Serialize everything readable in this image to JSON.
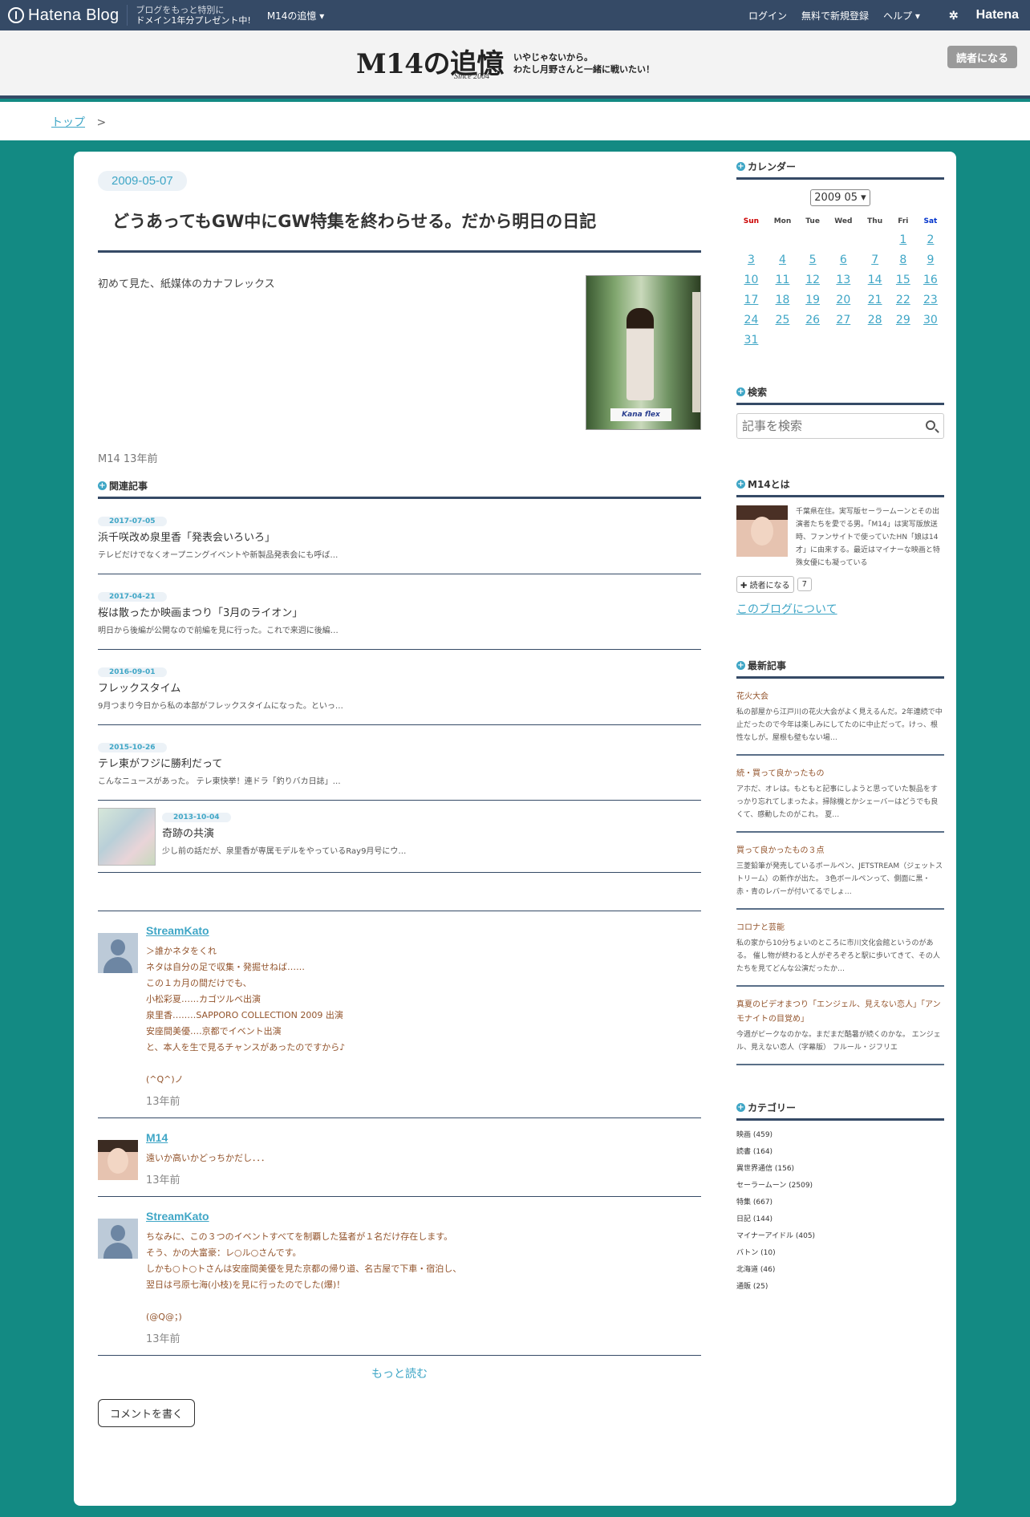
{
  "hatena_bar": {
    "logo_text": "Hatena Blog",
    "promo_line1": "ブログをもっと特別に",
    "promo_line2": "ドメイン1年分プレゼント中!",
    "blog_menu": "M14の追憶 ▾",
    "login": "ログイン",
    "signup": "無料で新規登録",
    "help": "ヘルプ ▾",
    "brand": "Hatena"
  },
  "blog_header": {
    "title": "M14の追憶",
    "since": "Since 2004",
    "desc_line1": "いやじゃないから。",
    "desc_line2": "わたし月野さんと一緒に戦いたい！",
    "subscribe": "読者になる"
  },
  "breadcrumb": {
    "top": "トップ",
    "sep": ">"
  },
  "entry": {
    "date": "2009-05-07",
    "title": "どうあってもGW中にGW特集を終わらせる。だから明日の日記",
    "body": "初めて見た、紙媒体のカナフレックス",
    "photo_logo": "Kana flex",
    "author": "M14",
    "time": "13年前"
  },
  "related": {
    "heading": "関連記事",
    "items": [
      {
        "date": "2017-07-05",
        "title": "浜千咲改め泉里香「発表会いろいろ」",
        "snippet": "テレビだけでなくオープニングイベントや新製品発表会にも呼ば…"
      },
      {
        "date": "2017-04-21",
        "title": "桜は散ったか映画まつり「3月のライオン」",
        "snippet": "明日から後編が公開なので前編を見に行った。これで来週に後編…"
      },
      {
        "date": "2016-09-01",
        "title": "フレックスタイム",
        "snippet": "9月つまり今日から私の本部がフレックスタイムになった。といっ…"
      },
      {
        "date": "2015-10-26",
        "title": "テレ東がフジに勝利だって",
        "snippet": "こんなニュースがあった。 テレ東快挙！連ドラ「釣りバカ日誌」…"
      },
      {
        "date": "2013-10-04",
        "title": "奇跡の共演",
        "snippet": "少し前の話だが、泉里香が専属モデルをやっているRay9月号にウ…"
      }
    ]
  },
  "comments": [
    {
      "name": "StreamKato",
      "lines": [
        "＞誰かネタをくれ",
        "ネタは自分の足で収集・発掘せねば‥‥‥",
        "この１カ月の間だけでも、",
        "小松彩夏‥‥‥カゴツルベ出演",
        "泉里香‥‥‥‥SAPPORO COLLECTION 2009 出演",
        "安座間美優‥‥京都でイベント出演",
        "と、本人を生で見るチャンスがあったのですから♪",
        "",
        "(^Q^)ノ"
      ],
      "time": "13年前"
    },
    {
      "name": "M14",
      "lines": [
        "遠いか高いかどっちかだし．．．"
      ],
      "time": "13年前"
    },
    {
      "name": "StreamKato",
      "lines": [
        "ちなみに、この３つのイベントすべてを制覇した猛者が１名だけ存在します。",
        "そう、かの大富豪：レ○ル○さんです。",
        "しかも○ト○トさんは安座間美優を見た京都の帰り道、名古屋で下車・宿泊し、",
        "翌日は弓原七海(小枝)を見に行ったのでした(爆)！",
        "",
        "(@Q@；)"
      ],
      "time": "13年前"
    }
  ],
  "more_label": "もっと読む",
  "write_comment": "コメントを書く",
  "sidebar": {
    "calendar": {
      "heading": "カレンダー",
      "selected": "2009 05",
      "weekdays": [
        "Sun",
        "Mon",
        "Tue",
        "Wed",
        "Thu",
        "Fri",
        "Sat"
      ],
      "weeks": [
        [
          "",
          "",
          "",
          "",
          "",
          "1",
          "2"
        ],
        [
          "3",
          "4",
          "5",
          "6",
          "7",
          "8",
          "9"
        ],
        [
          "10",
          "11",
          "12",
          "13",
          "14",
          "15",
          "16"
        ],
        [
          "17",
          "18",
          "19",
          "20",
          "21",
          "22",
          "23"
        ],
        [
          "24",
          "25",
          "26",
          "27",
          "28",
          "29",
          "30"
        ],
        [
          "31",
          "",
          "",
          "",
          "",
          "",
          ""
        ]
      ]
    },
    "search": {
      "heading": "検索",
      "placeholder": "記事を検索"
    },
    "about": {
      "heading": "M14とは",
      "desc": "千葉県在住。実写版セーラームーンとその出演者たちを愛でる男。「M14」は実写版放送時、ファンサイトで使っていたHN「娘は14才」に由来する。最近はマイナーな映画と特殊女優にも凝っている",
      "reader_btn": "読者になる",
      "reader_count": "7",
      "about_link": "このブログについて"
    },
    "recent": {
      "heading": "最新記事",
      "items": [
        {
          "title": "花火大会",
          "snippet": "私の部屋から江戸川の花火大会がよく見えるんだ。2年連続で中止だったので今年は楽しみにしてたのに中止だって。けっ、根性なしが。屋根も壁もない場…"
        },
        {
          "title": "続・買って良かったもの",
          "snippet": "アホだ、オレは。もともと記事にしようと思っていた製品をすっかり忘れてしまったよ。掃除機とかシェーバーはどうでも良くて、感動したのがこれ。 夏…"
        },
        {
          "title": "買って良かったもの３点",
          "snippet": "三菱鉛筆が発売しているボールペン、JETSTREAM（ジェットストリーム）の新作が出た。 3色ボールペンって、側面に黒・赤・青のレバーが付いてるでしょ…"
        },
        {
          "title": "コロナと芸能",
          "snippet": "私の家から10分ちょいのところに市川文化会館というのがある。 催し物が終わると人がぞろぞろと駅に歩いてきて、その人たちを見てどんな公演だったか…"
        },
        {
          "title": "真夏のビデオまつり「エンジェル、見えない恋人」「アンモナイトの目覚め」",
          "snippet": "今週がピークなのかな。まだまだ酷暑が続くのかな。 エンジェル、見えない恋人（字幕版） フルール・ジフリエ"
        }
      ]
    },
    "categories": {
      "heading": "カテゴリー",
      "items": [
        "映画 (459)",
        "読書 (164)",
        "異世界通信 (156)",
        "セーラームーン (2509)",
        "特集 (667)",
        "日記 (144)",
        "マイナーアイドル (405)",
        "バトン (10)",
        "北海道 (46)",
        "通販 (25)"
      ]
    }
  }
}
